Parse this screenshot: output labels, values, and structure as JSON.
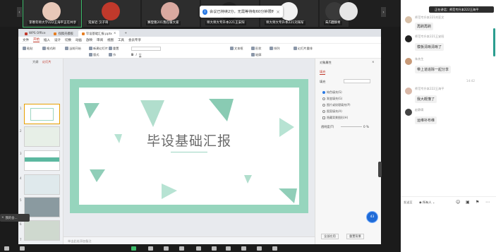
{
  "video_strip": {
    "tiles": [
      {
        "name": "李寒年师大学222王海平正在共享",
        "color": "#e8c8b8",
        "active": true
      },
      {
        "name": "常屏近 汉子哥",
        "color": "#c0392b"
      },
      {
        "name": "赛登隆201我在暖大家",
        "color": "#d9a9a0"
      },
      {
        "name": "师大师大专升本221王安阳",
        "color": "#222"
      },
      {
        "name": "师大师大专升本221刘海军",
        "color": "#f2f2f2"
      },
      {
        "name": "朱先生",
        "color": "#3a3a3a"
      },
      {
        "name": "赵静青",
        "color": "#e6e6e6"
      }
    ],
    "toast_text": "会议已持续2分，无需等待有60分钟限时会议"
  },
  "wps": {
    "tabs": [
      {
        "label": "WPS Office",
        "color": "#c0392b"
      },
      {
        "label": "找稿壳模板",
        "color": "#e67e22"
      },
      {
        "label": "毕设基础汇报.pptx",
        "color": "#e67e22",
        "active": true
      }
    ],
    "menu": [
      "文件",
      "开始",
      "插入",
      "设计",
      "切换",
      "动画",
      "放映",
      "审阅",
      "视图",
      "工具",
      "会员专享"
    ],
    "menu_active": "开始",
    "tools": [
      "粘贴",
      "格式刷",
      "当前开始",
      "新建幻灯片",
      "版式",
      "节",
      "重置",
      "文本框",
      "形状",
      "排列",
      "轮廓",
      "幻灯片重排"
    ],
    "thumb_tabs": [
      "大纲",
      "幻灯片"
    ],
    "slide_count": 7,
    "slide_title": "毕设基础汇报",
    "notes_placeholder": "单击此处添加备注",
    "panel": {
      "title": "对象属性",
      "tab": "填充",
      "section": "填充",
      "options": [
        "纯色填充(S)",
        "渐变填充(G)",
        "图片或纹理填充(P)",
        "图案填充(A)",
        "隐藏背景图形(H)"
      ],
      "option_selected": 0,
      "transparency_label": "透明度(T)",
      "transparency_value": "0 %",
      "apply_all": "全部应用",
      "reset": "重置背景"
    },
    "badge": "43"
  },
  "mini_toast": "我的会...",
  "chat": {
    "header_name": "正在讲话：师范专升本222王海平",
    "messages": [
      {
        "name": "师范专升本221刘亚文",
        "text": "再刷再刷",
        "avatar_color": "#d8c0a8"
      },
      {
        "name": "师范专升本221王安阳",
        "text": "模板清晰清晰了",
        "avatar_color": "#222"
      },
      {
        "name": "朱先生",
        "text": "带上道追除一起分享",
        "avatar_color": "#c89a78"
      },
      {
        "name": "师范专升本222王海平",
        "text": "我大概懂了",
        "avatar_color": "#d9b8a8"
      },
      {
        "name": "赵静青",
        "text": "运维补布维",
        "avatar_color": "#444"
      }
    ],
    "time": "14:42",
    "send_to": "发送至",
    "recipient": "所有人"
  }
}
